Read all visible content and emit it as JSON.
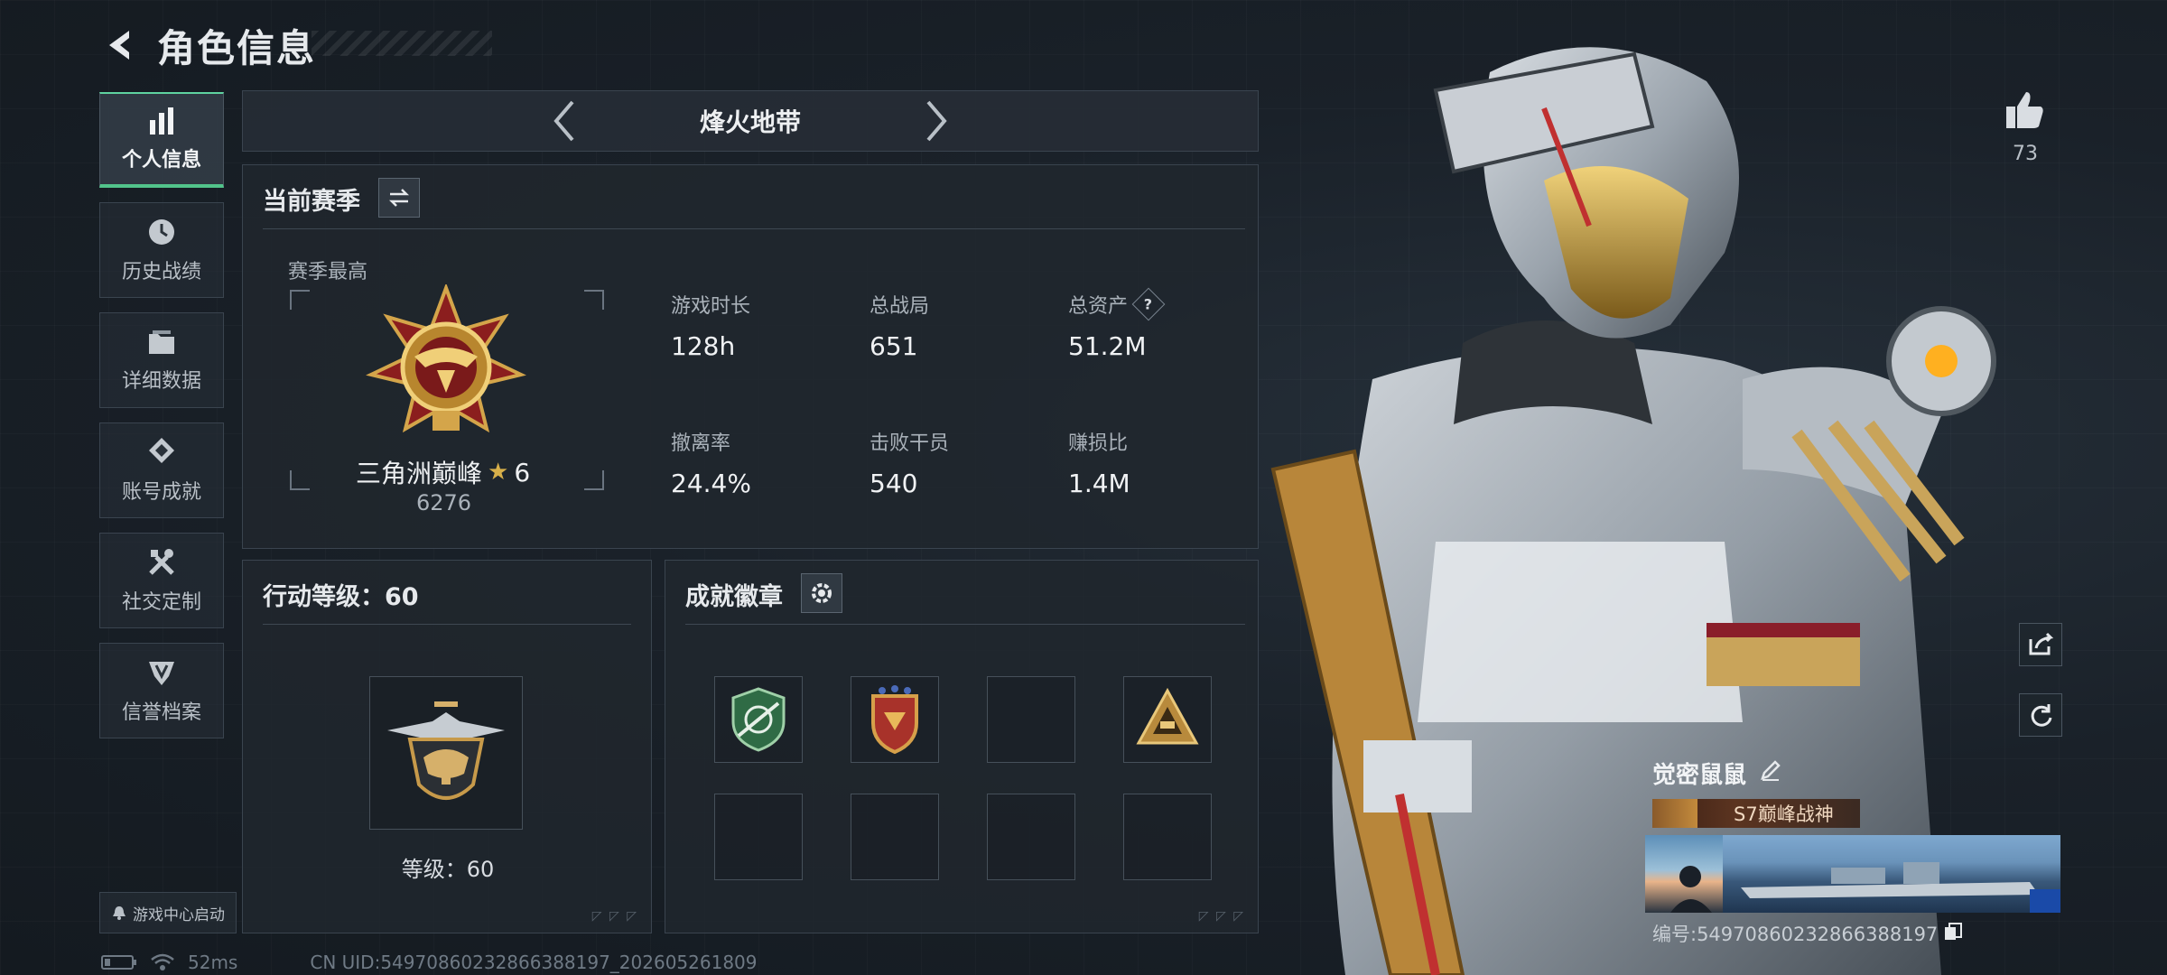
{
  "header": {
    "title": "角色信息"
  },
  "sidebar": {
    "items": [
      {
        "label": "个人信息",
        "icon": "bar-chart-icon",
        "active": true
      },
      {
        "label": "历史战绩",
        "icon": "history-icon"
      },
      {
        "label": "详细数据",
        "icon": "folder-icon"
      },
      {
        "label": "账号成就",
        "icon": "achievement-icon"
      },
      {
        "label": "社交定制",
        "icon": "tools-icon"
      },
      {
        "label": "信誉档案",
        "icon": "shield-icon"
      }
    ]
  },
  "mode": {
    "name": "烽火地带"
  },
  "season": {
    "title": "当前赛季",
    "best_label": "赛季最高",
    "rank_name": "三角洲巅峰",
    "rank_stars": "6",
    "rank_score": "6276",
    "stats": [
      {
        "label": "游戏时长",
        "value": "128h"
      },
      {
        "label": "总战局",
        "value": "651"
      },
      {
        "label": "总资产",
        "value": "51.2M",
        "help": "?"
      },
      {
        "label": "撤离率",
        "value": "24.4%"
      },
      {
        "label": "击败干员",
        "value": "540"
      },
      {
        "label": "赚损比",
        "value": "1.4M"
      }
    ]
  },
  "level": {
    "title": "行动等级：60",
    "text": "等级：60"
  },
  "badges": {
    "title": "成就徽章"
  },
  "social": {
    "likes": "73"
  },
  "player": {
    "name": "觉密鼠鼠",
    "title_plate": "S7巅峰战神",
    "id_text": "编号:5497086023286638819​7"
  },
  "footer": {
    "launch_label": "游戏中心启动",
    "ping": "52ms",
    "uid": "CN UID:5497086023286638819​7_202605261809"
  },
  "colors": {
    "accent": "#52c48b",
    "background": "#1a2129",
    "gold": "#d8b04a"
  }
}
